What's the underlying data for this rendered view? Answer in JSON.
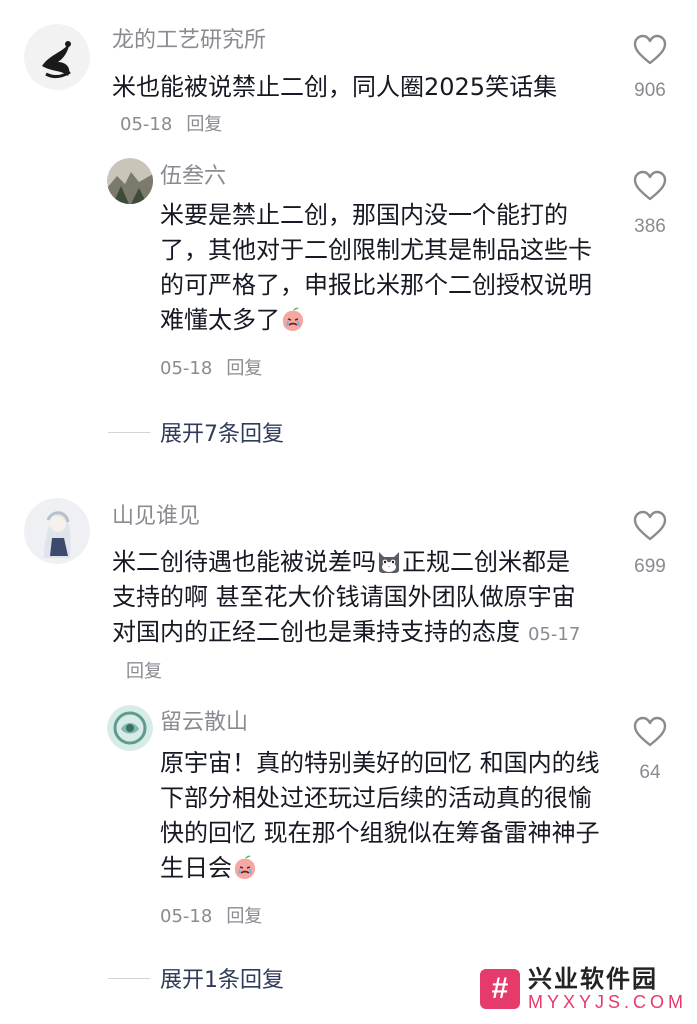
{
  "comments": [
    {
      "author": "龙的工艺研究所",
      "text": "米也能被说禁止二创，同人圈2025笑话集",
      "date": "05-18",
      "reply_label": "回复",
      "likes": "906",
      "replies": [
        {
          "author": "伍叁六",
          "text": "米要是禁止二创，那国内没一个能打的了，其他对于二创限制尤其是制品这些卡的可严格了，申报比米那个二创授权说明难懂太多了",
          "emoji": "crying-peach-emoji",
          "date": "05-18",
          "reply_label": "回复",
          "likes": "386"
        }
      ],
      "expand_label": "展开7条回复"
    },
    {
      "author": "山见谁见",
      "text_part1": "米二创待遇也能被说差吗",
      "emoji": "cat-face-emoji",
      "text_part2": "正规二创米都是支持的啊 甚至花大价钱请国外团队做原宇宙 对国内的正经二创也是秉持支持的态度",
      "date": "05-17",
      "reply_label": "回复",
      "likes": "699",
      "replies": [
        {
          "author": "留云散山",
          "text": "原宇宙！真的特别美好的回忆 和国内的线下部分相处过还玩过后续的活动真的很愉快的回忆 现在那个组貌似在筹备雷神神子生日会",
          "emoji": "crying-peach-emoji",
          "date": "05-18",
          "reply_label": "回复",
          "likes": "64"
        }
      ],
      "expand_label": "展开1条回复"
    }
  ],
  "watermark": {
    "logo": "#",
    "title": "兴业软件园",
    "subtitle": "MYXYJS.COM"
  }
}
